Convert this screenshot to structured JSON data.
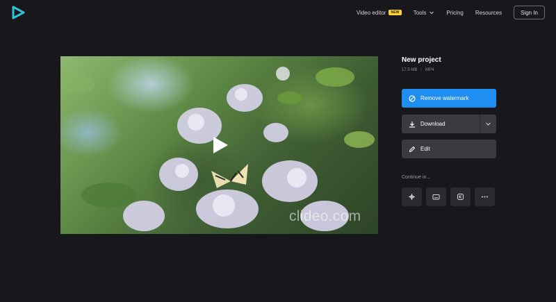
{
  "header": {
    "nav": {
      "video_editor": "Video editor",
      "new_badge": "NEW",
      "tools": "Tools",
      "pricing": "Pricing",
      "resources": "Resources",
      "sign_in": "Sign In"
    }
  },
  "preview": {
    "watermark": "clideo.com"
  },
  "project": {
    "title": "New project",
    "size": "17.5 MB",
    "format": "MP4"
  },
  "actions": {
    "remove_watermark": "Remove watermark",
    "download": "Download",
    "edit": "Edit"
  },
  "continue": {
    "label": "Continue in...",
    "tools": [
      "crop-tool-icon",
      "subtitles-tool-icon",
      "speed-tool-icon",
      "more-icon"
    ]
  },
  "colors": {
    "background": "#18181c",
    "primary": "#1f8ef2",
    "logo": "#2bc4d8",
    "badge": "#ffd43b"
  }
}
